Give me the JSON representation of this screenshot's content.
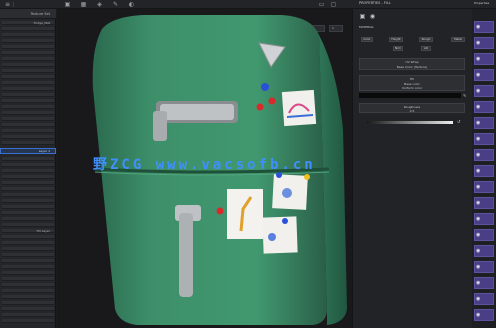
{
  "top_toolbar": {
    "icons": [
      "menu-icon",
      "paint-icon",
      "grid-icon",
      "layers-icon",
      "settings-icon"
    ],
    "right_tab": "Properties"
  },
  "left_panel": {
    "header": "Texture Set",
    "item_top": "Fridge_Mat",
    "selected_item": "Layer 1",
    "item_bottom": "Fill Layer"
  },
  "viewport": {
    "field_1": "Material  ▾",
    "field_2": "1"
  },
  "right_panel": {
    "tab_label": "PROPERTIES - FILL",
    "section_title": "MATERIAL",
    "buttons": [
      "Color",
      "Height",
      "Rough",
      "Metal"
    ],
    "row2": [
      "Nrm",
      "AO"
    ],
    "block1_line1": "UV Wrap",
    "block1_line2": "Base Color (Texture)",
    "block2_line1": "Fill",
    "block2_line2": "Base color",
    "block2_line3": "Uniform color",
    "block3_line1": "Roughness",
    "block3_line2": "0.5"
  },
  "watermark": "野ZCG  www.vacsofb.cn",
  "colors": {
    "fridge": "#3d8f6a",
    "fridge_shadow": "#2b6a4e",
    "accent": "#3a6fd0",
    "strip": "#4a3f86"
  }
}
